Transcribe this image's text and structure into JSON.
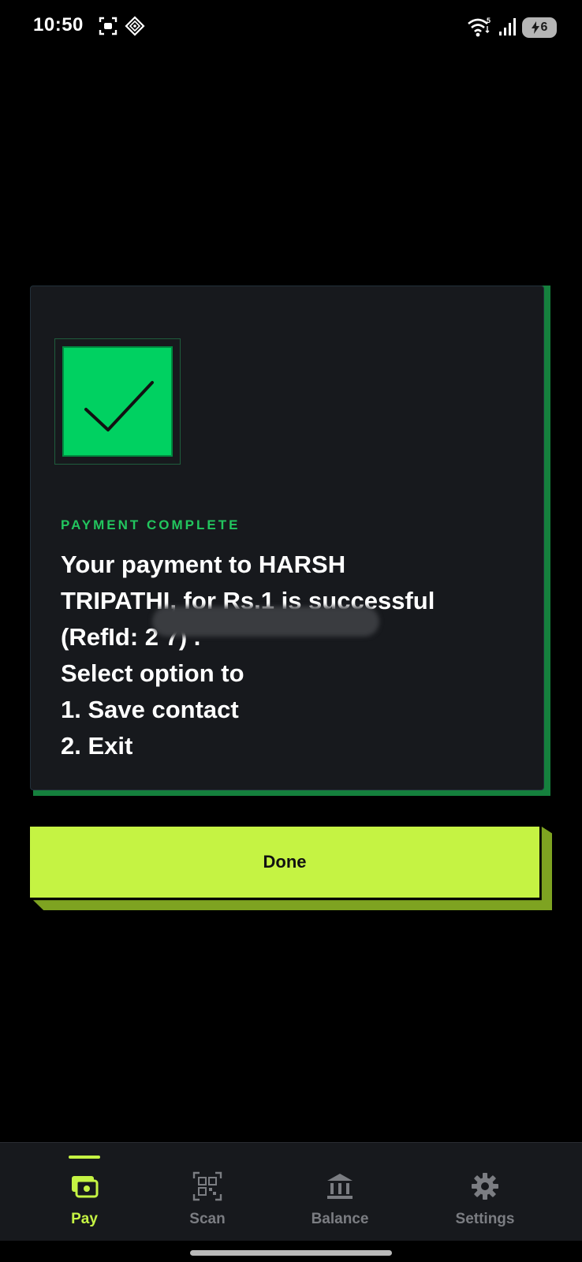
{
  "status_bar": {
    "time": "10:50",
    "battery": "6",
    "icons": [
      "screen-record-icon",
      "data-saver-icon",
      "wifi-icon",
      "signal-icon",
      "battery-icon"
    ]
  },
  "payment": {
    "status_label": "PAYMENT COMPLETE",
    "message": "Your payment to HARSH\nTRIPATHI, for Rs.1 is successful\n(RefId: 2                      7) .\nSelect option to\n1. Save contact\n2. Exit",
    "icon": "checkmark-icon"
  },
  "done_button": {
    "label": "Done"
  },
  "bottom_nav": {
    "items": [
      {
        "label": "Pay",
        "icon": "wallet-icon",
        "active": true
      },
      {
        "label": "Scan",
        "icon": "qr-scan-icon",
        "active": false
      },
      {
        "label": "Balance",
        "icon": "bank-icon",
        "active": false
      },
      {
        "label": "Settings",
        "icon": "gear-icon",
        "active": false
      }
    ]
  },
  "colors": {
    "background": "#000000",
    "card": "#17191d",
    "card_shadow": "#15803d",
    "success_green": "#00d161",
    "label_green": "#22c55e",
    "accent_lime": "#c5f343",
    "nav_inactive": "#7b7d82"
  }
}
